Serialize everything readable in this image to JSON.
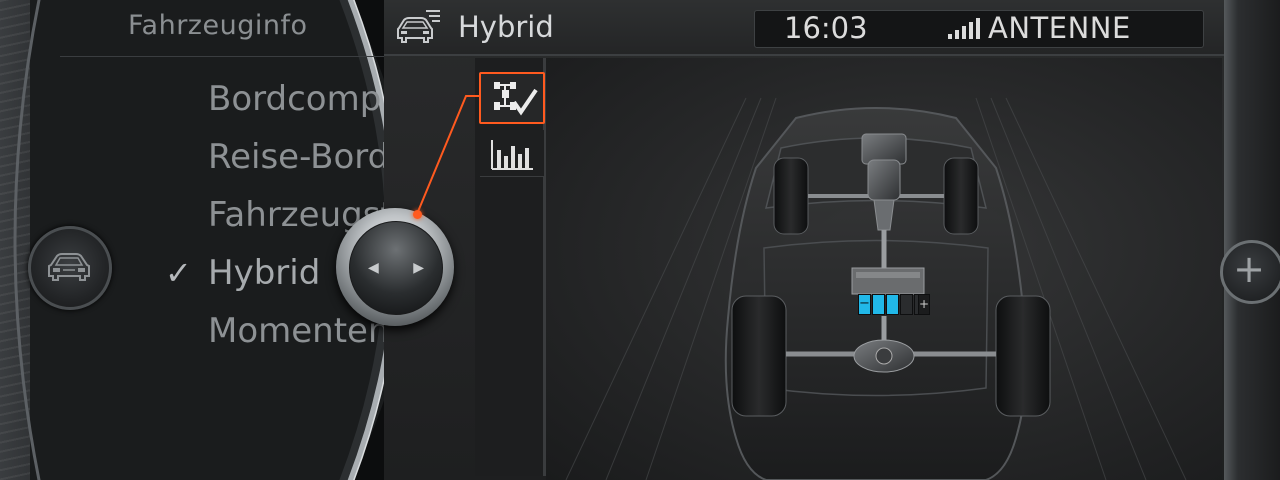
{
  "left_menu": {
    "header": "Fahrzeuginfo",
    "items": [
      {
        "label": "Bordcomp",
        "checked": false
      },
      {
        "label": "Reise-Bord",
        "checked": false
      },
      {
        "label": "Fahrzeugst",
        "checked": false
      },
      {
        "label": "Hybrid",
        "checked": true
      },
      {
        "label": "Momenten",
        "checked": false
      }
    ],
    "check_glyph": "✓",
    "side_icon": "car-front-icon"
  },
  "main": {
    "title": "Hybrid",
    "title_icon": "car-menu-icon"
  },
  "status": {
    "time": "16:03",
    "radio": "ANTENNE",
    "signal_icon": "signal-bars-icon"
  },
  "views": [
    {
      "name": "energy-flow-view",
      "icon": "car-drivetrain-check-icon",
      "selected": true
    },
    {
      "name": "history-view",
      "icon": "bar-chart-icon",
      "selected": false
    }
  ],
  "battery": {
    "minus_label": "−",
    "plus_label": "+",
    "segments_total": 5,
    "segments_filled": 3,
    "fill_color": "#21b8e8"
  },
  "right_knob_label": "+",
  "controller": {
    "left_arrow": "◀",
    "right_arrow": "▶"
  },
  "colors": {
    "accent": "#ff5a1f",
    "battery_fill": "#21b8e8"
  }
}
